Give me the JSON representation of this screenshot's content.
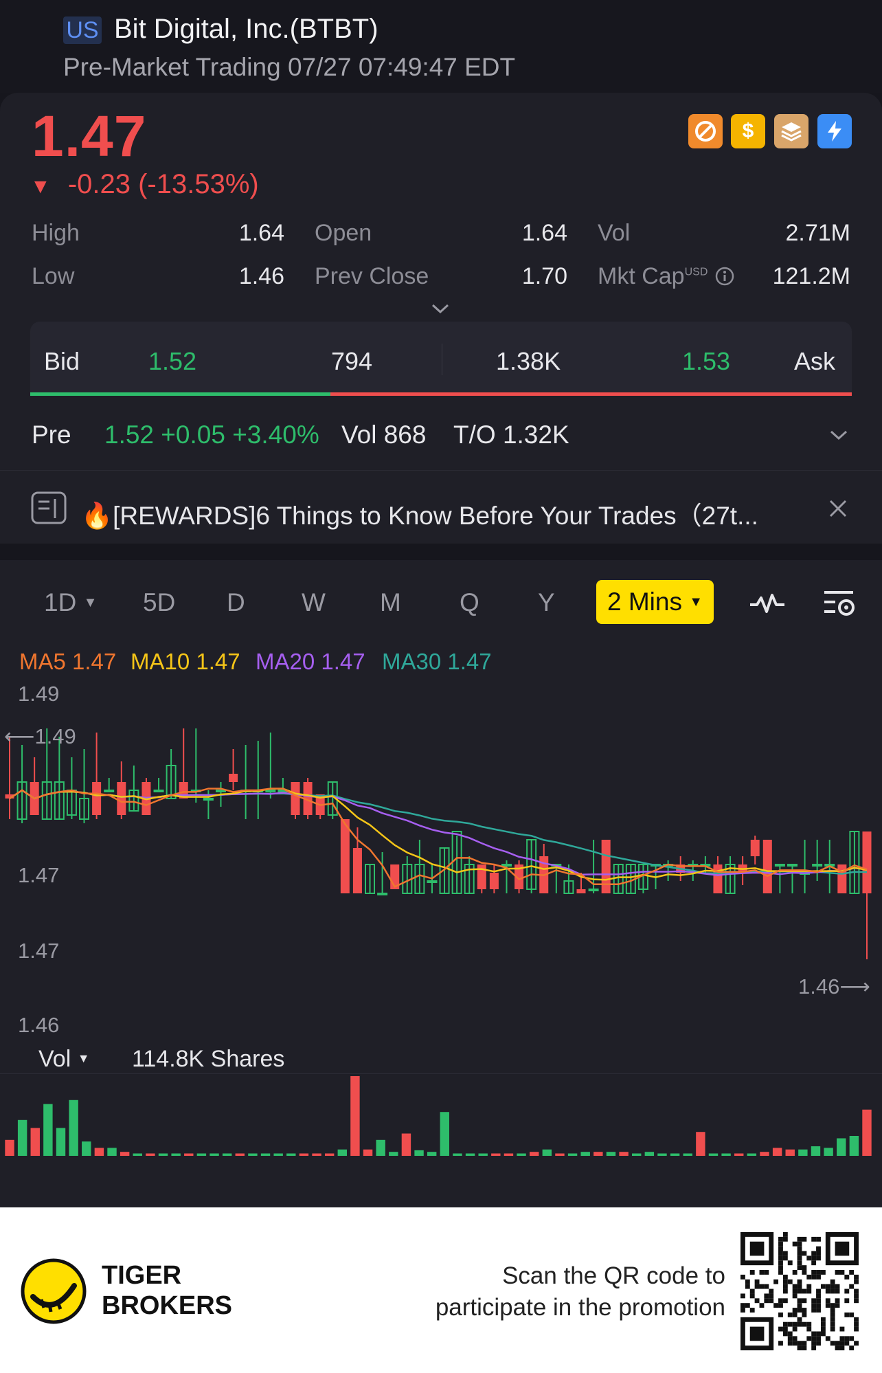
{
  "header": {
    "market": "US",
    "title": "Bit Digital, Inc.(BTBT)",
    "session_status": "Pre-Market Trading 07/27 07:49:47 EDT"
  },
  "quote": {
    "price": "1.47",
    "change": "-0.23 (-13.53%)",
    "direction": "down",
    "badges": [
      "no-sign-icon",
      "dollar-icon",
      "layers-icon",
      "lightning-icon"
    ],
    "stats": {
      "high_label": "High",
      "high": "1.64",
      "low_label": "Low",
      "low": "1.46",
      "open_label": "Open",
      "open": "1.64",
      "prev_close_label": "Prev Close",
      "prev_close": "1.70",
      "vol_label": "Vol",
      "vol": "2.71M",
      "mkt_cap_label": "Mkt Cap",
      "mkt_cap_unit": "USD",
      "mkt_cap": "121.2M"
    }
  },
  "bid_ask": {
    "bid_label": "Bid",
    "bid_price": "1.52",
    "bid_size": "794",
    "ask_size": "1.38K",
    "ask_price": "1.53",
    "ask_label": "Ask",
    "bid_ratio": 0.365
  },
  "pre_market": {
    "label": "Pre",
    "summary": "1.52 +0.05 +3.40%",
    "volume": "Vol 868",
    "turnover": "T/O 1.32K"
  },
  "news": {
    "text": "🔥[REWARDS]6 Things to Know Before Your Trades（27t..."
  },
  "chart_controls": {
    "tabs": [
      "1D",
      "5D",
      "D",
      "W",
      "M",
      "Q",
      "Y"
    ],
    "interval": "2 Mins"
  },
  "indicators": {
    "ma5": "MA5 1.47",
    "ma10": "MA10 1.47",
    "ma20": "MA20 1.47",
    "ma30": "MA30 1.47"
  },
  "chart_data": {
    "type": "candlestick",
    "y_axis_labels": [
      "1.49",
      "1.47",
      "1.47",
      "1.46"
    ],
    "high_marker": "1.49",
    "low_marker": "1.46",
    "ylim": [
      1.455,
      1.495
    ],
    "colors": {
      "up": "#2ebd6b",
      "down": "#f04e4e",
      "ma5": "#f0762f",
      "ma10": "#f5c518",
      "ma20": "#a65ff0",
      "ma30": "#2fa89a"
    },
    "candles": [
      {
        "o": 1.482,
        "c": 1.4815,
        "h": 1.489,
        "l": 1.479
      },
      {
        "o": 1.479,
        "c": 1.4835,
        "h": 1.488,
        "l": 1.4785
      },
      {
        "o": 1.4835,
        "c": 1.4795,
        "h": 1.4865,
        "l": 1.4795
      },
      {
        "o": 1.479,
        "c": 1.4835,
        "h": 1.49,
        "l": 1.479
      },
      {
        "o": 1.479,
        "c": 1.4835,
        "h": 1.489,
        "l": 1.479
      },
      {
        "o": 1.4795,
        "c": 1.4825,
        "h": 1.4865,
        "l": 1.479
      },
      {
        "o": 1.479,
        "c": 1.4815,
        "h": 1.4875,
        "l": 1.4785
      },
      {
        "o": 1.4835,
        "c": 1.4795,
        "h": 1.4895,
        "l": 1.479
      },
      {
        "o": 1.4825,
        "c": 1.4825,
        "h": 1.484,
        "l": 1.4825
      },
      {
        "o": 1.4835,
        "c": 1.4795,
        "h": 1.486,
        "l": 1.479
      },
      {
        "o": 1.48,
        "c": 1.4825,
        "h": 1.4855,
        "l": 1.48
      },
      {
        "o": 1.4835,
        "c": 1.4795,
        "h": 1.484,
        "l": 1.4795
      },
      {
        "o": 1.4825,
        "c": 1.4825,
        "h": 1.484,
        "l": 1.4825
      },
      {
        "o": 1.4815,
        "c": 1.4855,
        "h": 1.4875,
        "l": 1.4815
      },
      {
        "o": 1.4835,
        "c": 1.4815,
        "h": 1.49,
        "l": 1.4815
      },
      {
        "o": 1.4825,
        "c": 1.4825,
        "h": 1.49,
        "l": 1.481
      },
      {
        "o": 1.4815,
        "c": 1.4815,
        "h": 1.4825,
        "l": 1.479
      },
      {
        "o": 1.4825,
        "c": 1.4825,
        "h": 1.4835,
        "l": 1.4805
      },
      {
        "o": 1.4845,
        "c": 1.4835,
        "h": 1.4875,
        "l": 1.4825
      },
      {
        "o": 1.4825,
        "c": 1.4825,
        "h": 1.488,
        "l": 1.479
      },
      {
        "o": 1.4825,
        "c": 1.4825,
        "h": 1.4885,
        "l": 1.479
      },
      {
        "o": 1.4825,
        "c": 1.4825,
        "h": 1.4895,
        "l": 1.4815
      },
      {
        "o": 1.4825,
        "c": 1.4825,
        "h": 1.484,
        "l": 1.4825
      },
      {
        "o": 1.4835,
        "c": 1.4795,
        "h": 1.4835,
        "l": 1.479
      },
      {
        "o": 1.4835,
        "c": 1.4795,
        "h": 1.484,
        "l": 1.479
      },
      {
        "o": 1.482,
        "c": 1.4795,
        "h": 1.482,
        "l": 1.479
      },
      {
        "o": 1.4795,
        "c": 1.4835,
        "h": 1.4835,
        "l": 1.479
      },
      {
        "o": 1.479,
        "c": 1.47,
        "h": 1.479,
        "l": 1.47
      },
      {
        "o": 1.4755,
        "c": 1.47,
        "h": 1.478,
        "l": 1.47
      },
      {
        "o": 1.47,
        "c": 1.4735,
        "h": 1.4735,
        "l": 1.47
      },
      {
        "o": 1.47,
        "c": 1.47,
        "h": 1.475,
        "l": 1.47
      },
      {
        "o": 1.4735,
        "c": 1.4705,
        "h": 1.4735,
        "l": 1.4705
      },
      {
        "o": 1.47,
        "c": 1.4735,
        "h": 1.4745,
        "l": 1.47
      },
      {
        "o": 1.47,
        "c": 1.4735,
        "h": 1.4765,
        "l": 1.47
      },
      {
        "o": 1.4715,
        "c": 1.4715,
        "h": 1.4735,
        "l": 1.47
      },
      {
        "o": 1.47,
        "c": 1.4755,
        "h": 1.4755,
        "l": 1.47
      },
      {
        "o": 1.47,
        "c": 1.4775,
        "h": 1.477,
        "l": 1.47
      },
      {
        "o": 1.47,
        "c": 1.4735,
        "h": 1.4745,
        "l": 1.47
      },
      {
        "o": 1.4735,
        "c": 1.4705,
        "h": 1.4735,
        "l": 1.47
      },
      {
        "o": 1.4725,
        "c": 1.4705,
        "h": 1.4735,
        "l": 1.47
      },
      {
        "o": 1.4735,
        "c": 1.4735,
        "h": 1.474,
        "l": 1.47
      },
      {
        "o": 1.4735,
        "c": 1.4705,
        "h": 1.474,
        "l": 1.47
      },
      {
        "o": 1.4705,
        "c": 1.4765,
        "h": 1.4765,
        "l": 1.47
      },
      {
        "o": 1.4745,
        "c": 1.47,
        "h": 1.476,
        "l": 1.47
      },
      {
        "o": 1.4735,
        "c": 1.4735,
        "h": 1.4735,
        "l": 1.47
      },
      {
        "o": 1.47,
        "c": 1.4715,
        "h": 1.4735,
        "l": 1.47
      },
      {
        "o": 1.4705,
        "c": 1.47,
        "h": 1.4725,
        "l": 1.47
      },
      {
        "o": 1.4705,
        "c": 1.4705,
        "h": 1.4765,
        "l": 1.47
      },
      {
        "o": 1.4765,
        "c": 1.47,
        "h": 1.4765,
        "l": 1.47
      },
      {
        "o": 1.47,
        "c": 1.4735,
        "h": 1.4735,
        "l": 1.47
      },
      {
        "o": 1.47,
        "c": 1.4735,
        "h": 1.4735,
        "l": 1.47
      },
      {
        "o": 1.4705,
        "c": 1.4735,
        "h": 1.4735,
        "l": 1.47
      },
      {
        "o": 1.4735,
        "c": 1.4735,
        "h": 1.4735,
        "l": 1.4705
      },
      {
        "o": 1.4735,
        "c": 1.4735,
        "h": 1.474,
        "l": 1.4715
      },
      {
        "o": 1.4735,
        "c": 1.4725,
        "h": 1.4745,
        "l": 1.4715
      },
      {
        "o": 1.4735,
        "c": 1.4735,
        "h": 1.474,
        "l": 1.4715
      },
      {
        "o": 1.4735,
        "c": 1.4735,
        "h": 1.4745,
        "l": 1.4725
      },
      {
        "o": 1.4735,
        "c": 1.47,
        "h": 1.4745,
        "l": 1.47
      },
      {
        "o": 1.47,
        "c": 1.4735,
        "h": 1.4745,
        "l": 1.47
      },
      {
        "o": 1.4735,
        "c": 1.4725,
        "h": 1.4745,
        "l": 1.471
      },
      {
        "o": 1.4765,
        "c": 1.4745,
        "h": 1.477,
        "l": 1.4735
      },
      {
        "o": 1.4765,
        "c": 1.47,
        "h": 1.4765,
        "l": 1.47
      },
      {
        "o": 1.4735,
        "c": 1.4735,
        "h": 1.4735,
        "l": 1.47
      },
      {
        "o": 1.4735,
        "c": 1.4735,
        "h": 1.4735,
        "l": 1.47
      },
      {
        "o": 1.4725,
        "c": 1.4725,
        "h": 1.4765,
        "l": 1.47
      },
      {
        "o": 1.4735,
        "c": 1.4735,
        "h": 1.4765,
        "l": 1.4715
      },
      {
        "o": 1.4735,
        "c": 1.4735,
        "h": 1.4765,
        "l": 1.47
      },
      {
        "o": 1.4735,
        "c": 1.47,
        "h": 1.4735,
        "l": 1.47
      },
      {
        "o": 1.47,
        "c": 1.4775,
        "h": 1.4775,
        "l": 1.47
      },
      {
        "o": 1.4775,
        "c": 1.47,
        "h": 1.4775,
        "l": 1.462
      }
    ],
    "volume": [
      0.2,
      0.45,
      0.35,
      0.65,
      0.35,
      0.7,
      0.18,
      0.1,
      0.1,
      0.05,
      0.03,
      0.03,
      0.03,
      0.03,
      0.03,
      0.03,
      0.03,
      0.03,
      0.03,
      0.03,
      0.03,
      0.03,
      0.03,
      0.03,
      0.03,
      0.03,
      0.08,
      1.0,
      0.08,
      0.2,
      0.05,
      0.28,
      0.07,
      0.05,
      0.55,
      0.03,
      0.03,
      0.03,
      0.03,
      0.03,
      0.03,
      0.05,
      0.08,
      0.03,
      0.03,
      0.05,
      0.05,
      0.05,
      0.05,
      0.03,
      0.05,
      0.03,
      0.03,
      0.03,
      0.3,
      0.03,
      0.03,
      0.03,
      0.03,
      0.05,
      0.1,
      0.08,
      0.08,
      0.12,
      0.1,
      0.22,
      0.25,
      0.58
    ]
  },
  "volume_panel": {
    "label": "Vol",
    "total": "114.8K Shares"
  },
  "footer": {
    "brand_line1": "TIGER",
    "brand_line2": "BROKERS",
    "promo": "Scan the QR code to participate in the promotion"
  }
}
